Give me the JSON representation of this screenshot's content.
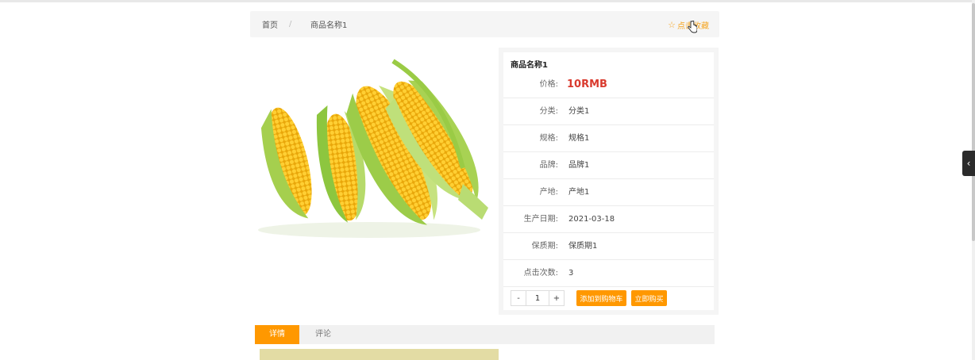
{
  "breadcrumb": {
    "home": "首页",
    "separator": "/",
    "current": "商品名称1"
  },
  "favorite": {
    "icon": "star-outline-icon",
    "label": "点击收藏"
  },
  "product": {
    "name": "商品名称1",
    "image": "corn-photo",
    "rows": [
      {
        "label": "价格:",
        "value": "10RMB"
      },
      {
        "label": "分类:",
        "value": "分类1"
      },
      {
        "label": "规格:",
        "value": "规格1"
      },
      {
        "label": "品牌:",
        "value": "品牌1"
      },
      {
        "label": "产地:",
        "value": "产地1"
      },
      {
        "label": "生产日期:",
        "value": "2021-03-18"
      },
      {
        "label": "保质期:",
        "value": "保质期1"
      },
      {
        "label": "点击次数:",
        "value": "3"
      }
    ]
  },
  "quantity": {
    "minus": "-",
    "value": "1",
    "plus": "+"
  },
  "actions": {
    "add_to_cart": "添加到购物车",
    "buy_now": "立即购买"
  },
  "tabs": [
    {
      "label": "详情",
      "active": true
    },
    {
      "label": "评论",
      "active": false
    }
  ],
  "side_toggle": {
    "icon": "chevron-left-icon",
    "glyph": "‹"
  },
  "colors": {
    "accent": "#ff9800",
    "favorite": "#f5a623",
    "price": "#d93a2e"
  }
}
